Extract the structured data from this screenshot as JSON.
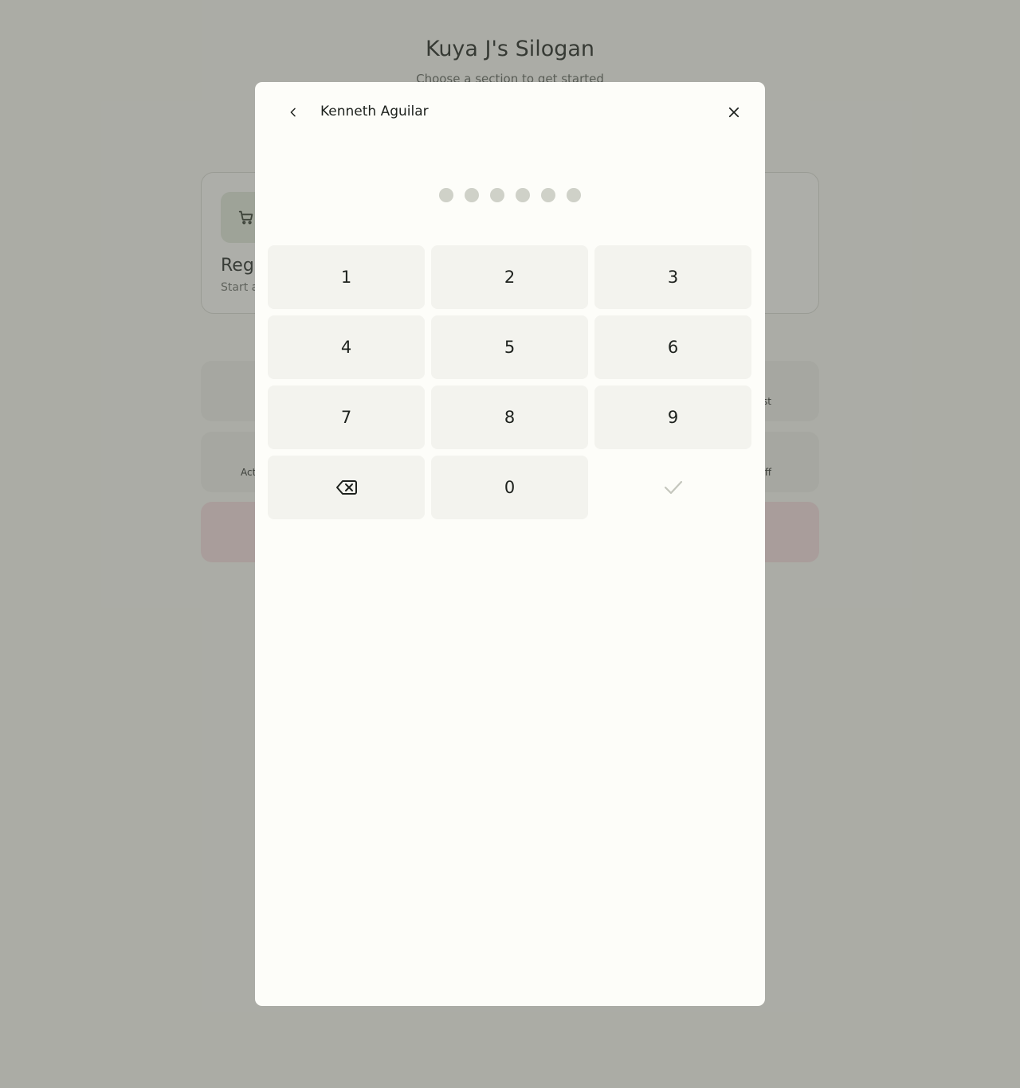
{
  "background": {
    "app_title": "Kuya J's Silogan",
    "app_subtitle": "Choose a section to get started",
    "register_card": {
      "title": "Register",
      "subtitle": "Start a new order"
    },
    "tiles": {
      "row1_right_label": "st",
      "row2_left_label": "Act",
      "row2_right_label": "ff"
    }
  },
  "modal": {
    "title": "Kenneth Aguilar",
    "pin_length": 6,
    "pin_entered": 0,
    "keys": {
      "k1": "1",
      "k2": "2",
      "k3": "3",
      "k4": "4",
      "k5": "5",
      "k6": "6",
      "k7": "7",
      "k8": "8",
      "k9": "9",
      "k0": "0"
    },
    "icons": {
      "back": "chevron-left-icon",
      "close": "close-icon",
      "backspace": "backspace-icon",
      "confirm": "check-icon"
    }
  },
  "colors": {
    "overlay": "#55584f",
    "pin_dot_empty": "#cfd1c8",
    "key_background": "#f3f3ee",
    "danger_bar": "#f4dcde"
  }
}
